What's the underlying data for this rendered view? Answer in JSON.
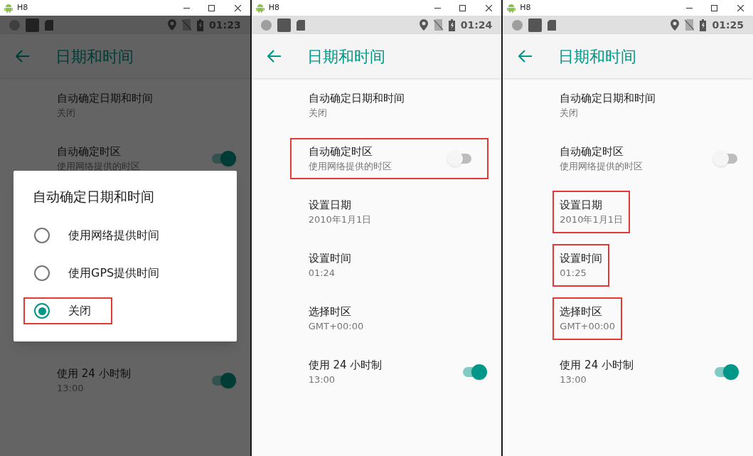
{
  "panels": [
    {
      "window_title": "H8",
      "status_time": "01:23",
      "page_title": "日期和时间",
      "items": [
        {
          "kind": "text",
          "title": "自动确定日期和时间",
          "subtitle": "关闭",
          "highlighted": false
        },
        {
          "kind": "toggle",
          "title": "自动确定时区",
          "subtitle": "使用网络提供的时区",
          "on": true,
          "highlighted": false
        },
        {
          "kind": "dialog",
          "title": "自动确定日期和时间",
          "options": [
            {
              "label": "使用网络提供时间",
              "selected": false,
              "highlighted": false
            },
            {
              "label": "使用GPS提供时间",
              "selected": false,
              "highlighted": false
            },
            {
              "label": "关闭",
              "selected": true,
              "highlighted": true
            }
          ]
        },
        {
          "kind": "toggle",
          "title": "使用 24 小时制",
          "subtitle": "13:00",
          "on": true,
          "highlighted": false
        }
      ]
    },
    {
      "window_title": "H8",
      "status_time": "01:24",
      "page_title": "日期和时间",
      "items": [
        {
          "kind": "text",
          "title": "自动确定日期和时间",
          "subtitle": "关闭",
          "highlighted": false
        },
        {
          "kind": "toggle",
          "title": "自动确定时区",
          "subtitle": "使用网络提供的时区",
          "on": false,
          "highlighted": true
        },
        {
          "kind": "text",
          "title": "设置日期",
          "subtitle": "2010年1月1日",
          "highlighted": false
        },
        {
          "kind": "text",
          "title": "设置时间",
          "subtitle": "01:24",
          "highlighted": false
        },
        {
          "kind": "text",
          "title": "选择时区",
          "subtitle": "GMT+00:00",
          "highlighted": false
        },
        {
          "kind": "toggle",
          "title": "使用 24 小时制",
          "subtitle": "13:00",
          "on": true,
          "highlighted": false
        }
      ]
    },
    {
      "window_title": "H8",
      "status_time": "01:25",
      "page_title": "日期和时间",
      "items": [
        {
          "kind": "text",
          "title": "自动确定日期和时间",
          "subtitle": "关闭",
          "highlighted": false
        },
        {
          "kind": "toggle",
          "title": "自动确定时区",
          "subtitle": "使用网络提供的时区",
          "on": false,
          "highlighted": false
        },
        {
          "kind": "text",
          "title": "设置日期",
          "subtitle": "2010年1月1日",
          "highlighted": true
        },
        {
          "kind": "text",
          "title": "设置时间",
          "subtitle": "01:25",
          "highlighted": true
        },
        {
          "kind": "text",
          "title": "选择时区",
          "subtitle": "GMT+00:00",
          "highlighted": true
        },
        {
          "kind": "toggle",
          "title": "使用 24 小时制",
          "subtitle": "13:00",
          "on": true,
          "highlighted": false
        }
      ]
    }
  ]
}
